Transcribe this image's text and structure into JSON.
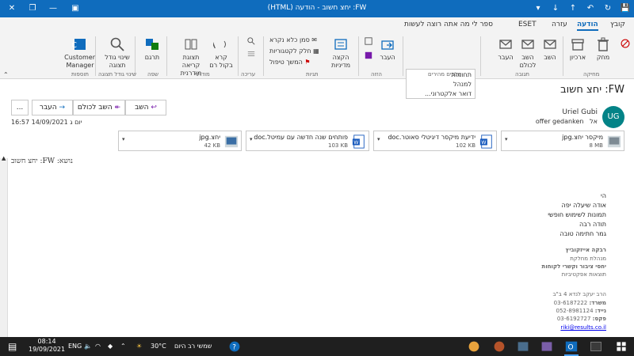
{
  "window": {
    "title": "FW: יחצ חשוב - הודעה (HTML)",
    "colors": {
      "titlebar": "#0f6cbd",
      "taskbar": "#1f1f1f",
      "avatar": "#038387"
    }
  },
  "tabs": [
    "קובץ",
    "הודעה",
    "עזרה",
    "ESET",
    "ספר לי מה אתה רוצה לעשות"
  ],
  "ribbon": {
    "delete": {
      "label": "מחק",
      "archive": "ארכיון"
    },
    "move": {
      "label": "העבר"
    },
    "respond": {
      "reply": "השב",
      "reply_all": "השב לכולם",
      "forward": "העבר"
    },
    "quick_steps": [
      "תחומות",
      "למנהל",
      "דואר אלקטרוני..."
    ],
    "tags": {
      "unread": "סמן כלא נקרא",
      "categorize": "חלק לקטגוריות",
      "followup": "המשך טיפול"
    },
    "policy": "הקצה מדיניות",
    "editing": {
      "find": "עריכה"
    },
    "immersive": {
      "read_aloud": "קרא בקול רם",
      "reader": "תצוגת קריאה מודרנית"
    },
    "translate": "תרגם",
    "zoom": "שינוי גודל תצוגה",
    "customer_manager": "Customer Manager",
    "groups": [
      "מחיקה",
      "תגובה",
      "שלבים מהירים",
      "הזזה",
      "תגיות",
      "עריכה",
      "מודרני",
      "שפה",
      "שינוי גודל תצוגה",
      "תוספות"
    ]
  },
  "message": {
    "subject": "FW: יחצ חשוב",
    "actions": {
      "reply": "השב",
      "reply_all": "השב לכולם",
      "forward": "העבר",
      "more": "..."
    },
    "sender": {
      "initials": "UG",
      "name": "Uriel Gubi",
      "to_label": "אל",
      "to": "offer gedanken"
    },
    "date": "יום ג 14/09/2021 16:57",
    "attachments": [
      {
        "name": "מיקסר יחצ.jpg",
        "size": "8 MB"
      },
      {
        "name": "ידיעת מיקסר דיגיטלי סאוטר.doc",
        "size": "102 KB"
      },
      {
        "name": "פותחים שנה חדשה עם עמיטל.doc",
        "size": "103 KB"
      },
      {
        "name": "יחצ.jpg",
        "size": "42 KB"
      }
    ],
    "body_subject": "נושא: FW: יחצ חשוב",
    "body": [
      "הי",
      "אודה שיעלה יפה",
      "תמונות לשימוש חופשי",
      "תודה רבה",
      "גמר חתימה טובה"
    ],
    "signature": {
      "name": "רבקה אייזקוביץ",
      "role": "מנהלת מחלקת",
      "dept": "יחסי ציבור וקשרי לקוחות",
      "company": "תוצאות אפקטיביות",
      "address": "הרב יעקב לנדא 4 ב\"ב",
      "office_label": "משרד:",
      "office": "03-6187222",
      "mobile_label": "נייד:",
      "mobile": "052-8981124",
      "fax_label": "פקס:",
      "fax": "03-6192727",
      "email": "riki@results.co.il"
    }
  },
  "taskbar": {
    "weather": "30°C",
    "weather_text": "שמשי רב היום",
    "lang": "ENG",
    "time": "08:14",
    "date": "19/09/2021"
  }
}
